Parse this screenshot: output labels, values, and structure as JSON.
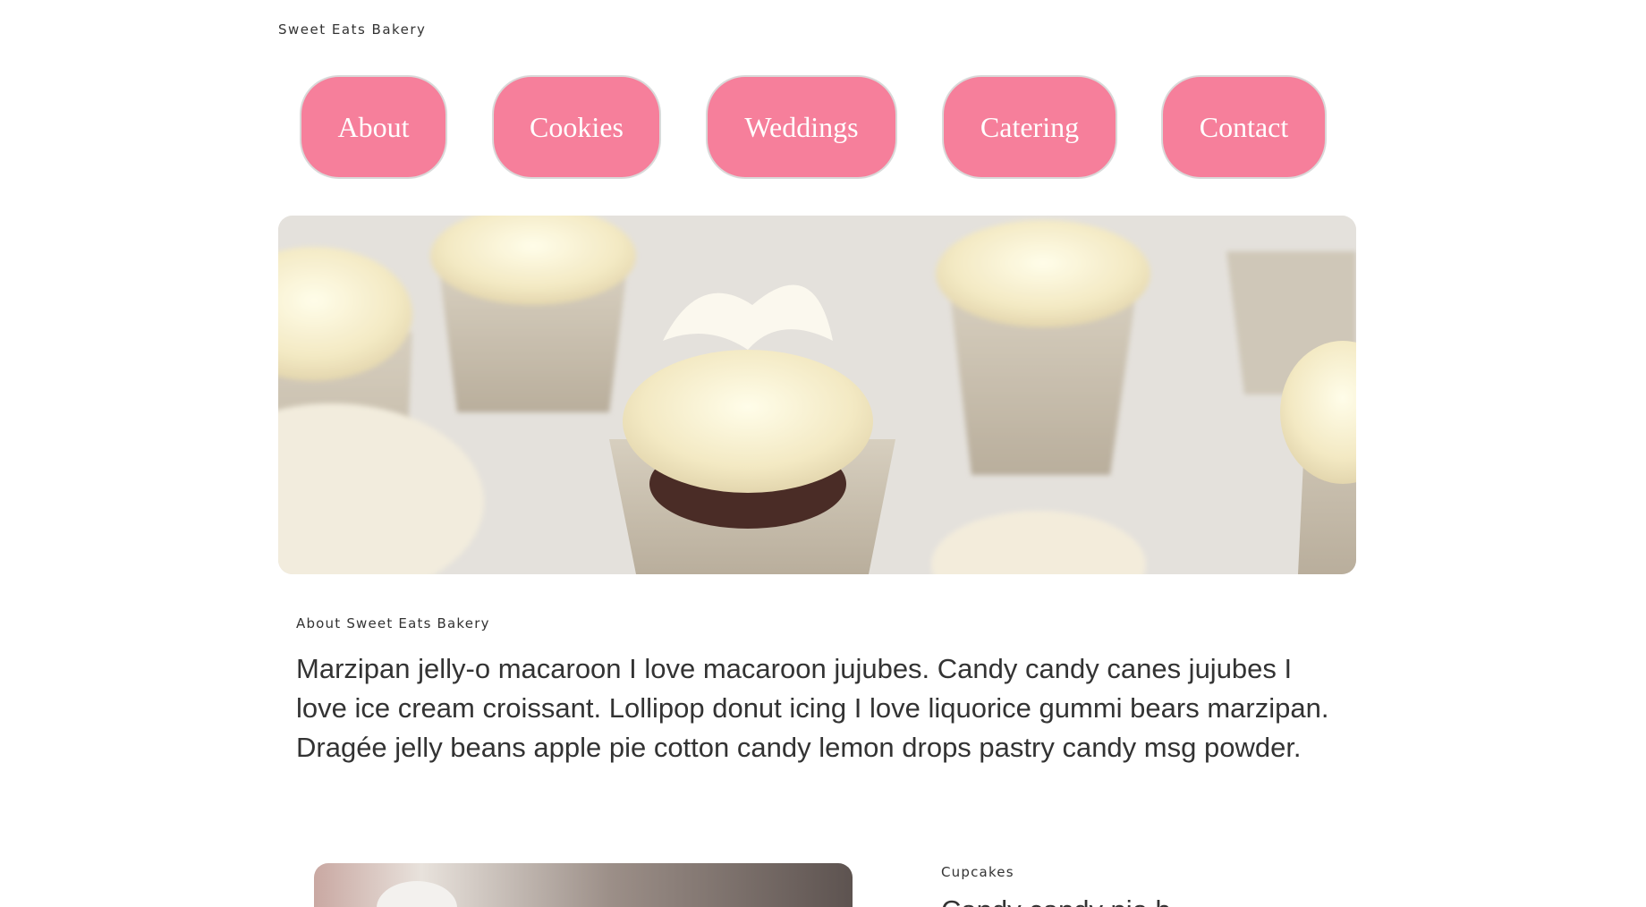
{
  "site": {
    "title": "Sweet Eats Bakery"
  },
  "nav": {
    "items": [
      {
        "label": "About"
      },
      {
        "label": "Cookies"
      },
      {
        "label": "Weddings"
      },
      {
        "label": "Catering"
      },
      {
        "label": "Contact"
      }
    ]
  },
  "hero": {
    "subject": "cupcakes-photo"
  },
  "about": {
    "label": "About Sweet Eats Bakery",
    "body": "Marzipan jelly-o macaroon I love macaroon jujubes. Candy candy canes jujubes I love ice cream croissant. Lollipop donut icing I love liquorice gummi bears marzipan. Dragée jelly beans apple pie cotton candy lemon drops pastry candy msg powder."
  },
  "cupcakes": {
    "label": "Cupcakes",
    "heading": "Candy candy pie b"
  },
  "colors": {
    "nav_button": "#f67f9b",
    "nav_text": "#ffffff",
    "body_text": "#333333"
  }
}
